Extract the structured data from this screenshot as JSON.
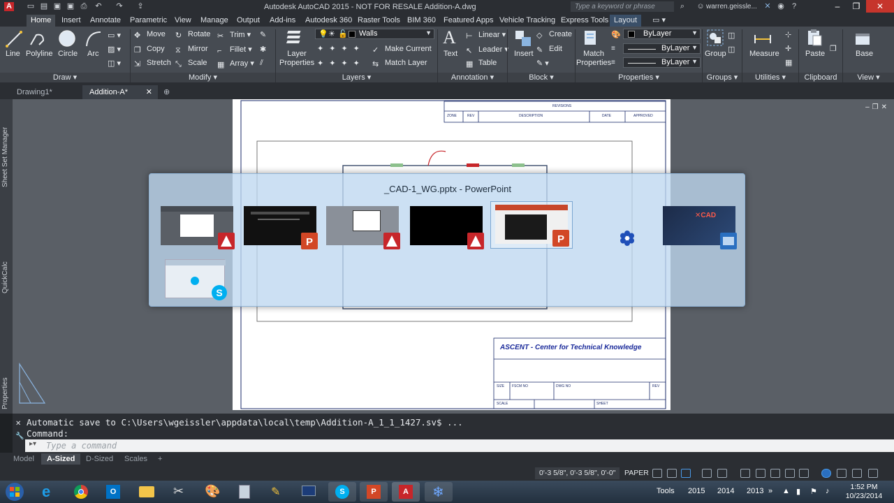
{
  "titlebar": {
    "title": "Autodesk AutoCAD 2015 - NOT FOR RESALE   Addition-A.dwg",
    "search_placeholder": "Type a keyword or phrase",
    "user": "warren.geissle..."
  },
  "ribbon_tabs": [
    "Home",
    "Insert",
    "Annotate",
    "Parametric",
    "View",
    "Manage",
    "Output",
    "Add-ins",
    "Autodesk 360",
    "Raster Tools",
    "BIM 360",
    "Featured Apps",
    "Vehicle Tracking",
    "Express Tools",
    "Layout"
  ],
  "ribbon": {
    "draw": {
      "title": "Draw",
      "line": "Line",
      "polyline": "Polyline",
      "circle": "Circle",
      "arc": "Arc"
    },
    "modify": {
      "title": "Modify",
      "move": "Move",
      "rotate": "Rotate",
      "trim": "Trim",
      "copy": "Copy",
      "mirror": "Mirror",
      "fillet": "Fillet",
      "stretch": "Stretch",
      "scale": "Scale",
      "array": "Array"
    },
    "layers": {
      "title": "Layers",
      "layer_properties": "Layer\nProperties",
      "current_layer": "Walls",
      "make_current": "Make Current",
      "match_layer": "Match Layer"
    },
    "annotation": {
      "title": "Annotation",
      "text": "Text",
      "linear": "Linear",
      "leader": "Leader",
      "table": "Table"
    },
    "block": {
      "title": "Block",
      "insert": "Insert",
      "create": "Create",
      "edit": "Edit"
    },
    "properties": {
      "title": "Properties",
      "match_properties": "Match\nProperties",
      "color": "ByLayer",
      "linetype": "ByLayer",
      "lineweight": "ByLayer"
    },
    "groups": {
      "title": "Groups",
      "group": "Group"
    },
    "utilities": {
      "title": "Utilities",
      "measure": "Measure"
    },
    "clipboard": {
      "title": "Clipboard",
      "paste": "Paste"
    },
    "view": {
      "title": "View",
      "base": "Base"
    }
  },
  "doc_tabs": [
    "Drawing1*",
    "Addition-A*"
  ],
  "side_palettes": [
    "Sheet Set Manager",
    "QuickCalc",
    "Properties"
  ],
  "title_block": {
    "revisions": "REVISIONS",
    "zone": "ZONE",
    "rev": "REV",
    "description": "DESCRIPTION",
    "date": "DATE",
    "approved": "APPROVED",
    "company": "ASCENT - Center for Technical Knowledge",
    "size": "SIZE",
    "fscm": "FSCM NO",
    "dwg": "DWG NO",
    "rev2": "REV",
    "scale": "SCALE",
    "sheet": "SHEET"
  },
  "alttab": {
    "title": "_CAD-1_WG.pptx - PowerPoint"
  },
  "command": {
    "history_line": "Automatic save to C:\\Users\\wgeissler\\appdata\\local\\temp\\Addition-A_1_1_1427.sv$ ...",
    "prompt_line": "Command:",
    "placeholder": "Type a command"
  },
  "layout_tabs": [
    "Model",
    "A-Sized",
    "D-Sized",
    "Scales"
  ],
  "status": {
    "coords": "0'-3 5/8\", 0'-3 5/8\", 0'-0\"",
    "space": "PAPER"
  },
  "taskbar": {
    "tray_items": [
      "Tools",
      "2015",
      "2014",
      "2013"
    ],
    "time": "1:52 PM",
    "date": "10/23/2014"
  },
  "colors": {
    "autocad_red": "#c7262a",
    "powerpoint_orange": "#d24726",
    "skype_blue": "#00aff0",
    "ribbon_bg": "#464b52",
    "canvas_bg": "#5a5f66"
  }
}
